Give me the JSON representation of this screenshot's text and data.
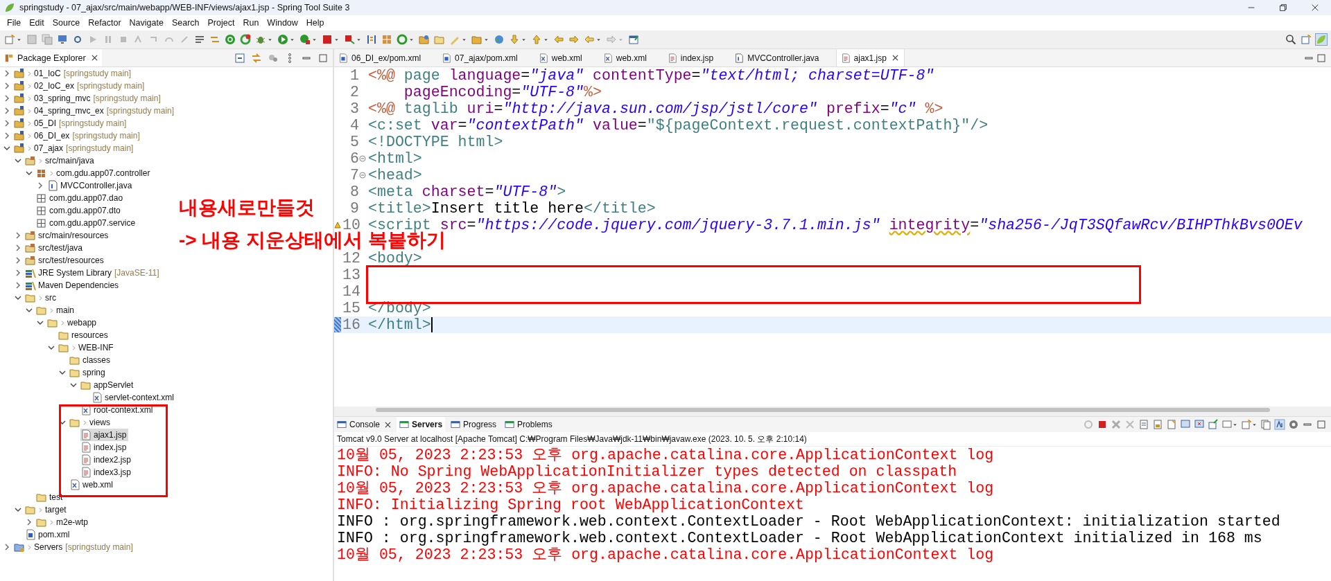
{
  "window": {
    "title": "springstudy - 07_ajax/src/main/webapp/WEB-INF/views/ajax1.jsp - Spring Tool Suite 3"
  },
  "menu": [
    "File",
    "Edit",
    "Source",
    "Refactor",
    "Navigate",
    "Search",
    "Project",
    "Run",
    "Window",
    "Help"
  ],
  "explorer": {
    "title": "Package Explorer",
    "items": [
      {
        "label": "01_IoC",
        "decoration": "[springstudy main]",
        "kind": "project",
        "dirty": true,
        "expanded": false,
        "selected": false
      },
      {
        "label": "02_IoC_ex",
        "decoration": "[springstudy main]",
        "kind": "project",
        "dirty": true,
        "expanded": false,
        "selected": false
      },
      {
        "label": "03_spring_mvc",
        "decoration": "[springstudy main]",
        "kind": "project",
        "dirty": true,
        "expanded": false,
        "selected": false
      },
      {
        "label": "04_spring_mvc_ex",
        "decoration": "[springstudy main]",
        "kind": "project",
        "dirty": true,
        "expanded": false,
        "selected": false
      },
      {
        "label": "05_DI",
        "decoration": "[springstudy main]",
        "kind": "project",
        "dirty": true,
        "expanded": false,
        "selected": false
      },
      {
        "label": "06_DI_ex",
        "decoration": "[springstudy main]",
        "kind": "project",
        "dirty": true,
        "expanded": false,
        "selected": false
      },
      {
        "label": "07_ajax",
        "decoration": "[springstudy main]",
        "kind": "project",
        "dirty": true,
        "expanded": true,
        "selected": false,
        "children": [
          {
            "label": "src/main/java",
            "kind": "source",
            "dirty": true,
            "expanded": true,
            "selected": false,
            "children": [
              {
                "label": "com.gdu.app07.controller",
                "kind": "package",
                "dirty": true,
                "expanded": true,
                "selected": false,
                "children": [
                  {
                    "label": "MVCController.java",
                    "kind": "java",
                    "dirty": false,
                    "expanded": false,
                    "selected": false
                  }
                ]
              },
              {
                "label": "com.gdu.app07.dao",
                "kind": "empty-package",
                "dirty": false,
                "selected": false
              },
              {
                "label": "com.gdu.app07.dto",
                "kind": "empty-package",
                "dirty": false,
                "selected": false
              },
              {
                "label": "com.gdu.app07.service",
                "kind": "empty-package",
                "dirty": false,
                "selected": false
              }
            ]
          },
          {
            "label": "src/main/resources",
            "kind": "source",
            "dirty": false,
            "expanded": false,
            "selected": false
          },
          {
            "label": "src/test/java",
            "kind": "source",
            "dirty": false,
            "expanded": false,
            "selected": false
          },
          {
            "label": "src/test/resources",
            "kind": "source",
            "dirty": false,
            "expanded": false,
            "selected": false
          },
          {
            "label": "JRE System Library",
            "decoration": "[JavaSE-11]",
            "kind": "library",
            "dirty": false,
            "expanded": false,
            "selected": false
          },
          {
            "label": "Maven Dependencies",
            "kind": "library",
            "dirty": false,
            "expanded": false,
            "selected": false
          },
          {
            "label": "src",
            "kind": "folder",
            "dirty": true,
            "expanded": true,
            "selected": false,
            "children": [
              {
                "label": "main",
                "kind": "folder",
                "dirty": true,
                "expanded": true,
                "selected": false,
                "children": [
                  {
                    "label": "webapp",
                    "kind": "folder",
                    "dirty": true,
                    "expanded": true,
                    "selected": false,
                    "children": [
                      {
                        "label": "resources",
                        "kind": "folder",
                        "dirty": false,
                        "selected": false
                      },
                      {
                        "label": "WEB-INF",
                        "kind": "folder",
                        "dirty": true,
                        "expanded": true,
                        "selected": false,
                        "children": [
                          {
                            "label": "classes",
                            "kind": "folder",
                            "dirty": false,
                            "selected": false
                          },
                          {
                            "label": "spring",
                            "kind": "folder",
                            "dirty": false,
                            "expanded": true,
                            "selected": false,
                            "children": [
                              {
                                "label": "appServlet",
                                "kind": "folder",
                                "dirty": false,
                                "expanded": true,
                                "selected": false,
                                "children": [
                                  {
                                    "label": "servlet-context.xml",
                                    "kind": "xml",
                                    "dirty": false,
                                    "selected": false
                                  }
                                ]
                              },
                              {
                                "label": "root-context.xml",
                                "kind": "xml",
                                "dirty": false,
                                "selected": false
                              }
                            ]
                          },
                          {
                            "label": "views",
                            "kind": "folder",
                            "dirty": true,
                            "expanded": true,
                            "selected": false,
                            "children": [
                              {
                                "label": "ajax1.jsp",
                                "kind": "jsp",
                                "dirty": false,
                                "selected": true
                              },
                              {
                                "label": "index.jsp",
                                "kind": "jsp",
                                "dirty": false,
                                "selected": false
                              },
                              {
                                "label": "index2.jsp",
                                "kind": "jsp",
                                "dirty": false,
                                "selected": false
                              },
                              {
                                "label": "index3.jsp",
                                "kind": "jsp",
                                "dirty": false,
                                "selected": false
                              }
                            ]
                          },
                          {
                            "label": "web.xml",
                            "kind": "xml",
                            "dirty": false,
                            "selected": false
                          }
                        ]
                      }
                    ]
                  }
                ]
              },
              {
                "label": "test",
                "kind": "folder",
                "dirty": false,
                "selected": false
              }
            ]
          },
          {
            "label": "target",
            "kind": "folder",
            "dirty": true,
            "expanded": true,
            "selected": false,
            "children": [
              {
                "label": "m2e-wtp",
                "kind": "folder",
                "dirty": true,
                "expanded": false,
                "selected": false
              }
            ]
          },
          {
            "label": "pom.xml",
            "kind": "pom",
            "dirty": false,
            "selected": false
          }
        ]
      },
      {
        "label": "Servers",
        "decoration": "[springstudy main]",
        "kind": "servers",
        "dirty": true,
        "expanded": false,
        "selected": false
      }
    ]
  },
  "editor": {
    "tabs": [
      {
        "label": "06_DI_ex/pom.xml",
        "kind": "pom",
        "selected": false
      },
      {
        "label": "07_ajax/pom.xml",
        "kind": "pom",
        "selected": false
      },
      {
        "label": "web.xml",
        "kind": "xml",
        "selected": false
      },
      {
        "label": "web.xml",
        "kind": "xml",
        "selected": false
      },
      {
        "label": "index.jsp",
        "kind": "jsp",
        "selected": false
      },
      {
        "label": "MVCController.java",
        "kind": "java",
        "selected": false
      },
      {
        "label": "ajax1.jsp",
        "kind": "jsp",
        "selected": true
      }
    ],
    "lines": [
      {
        "number": "1",
        "current": false,
        "tokens": [
          {
            "t": "<%@",
            "kind": "dir"
          },
          {
            "t": " page",
            "kind": "tag"
          },
          {
            "t": " language",
            "kind": "attr"
          },
          {
            "t": "=",
            "kind": "text"
          },
          {
            "t": "\"java\"",
            "kind": "value"
          },
          {
            "t": " contentType",
            "kind": "attr"
          },
          {
            "t": "=",
            "kind": "text"
          },
          {
            "t": "\"text/html; charset=UTF-8\"",
            "kind": "value"
          }
        ]
      },
      {
        "number": "2",
        "current": false,
        "tokens": [
          {
            "t": "    pageEncoding",
            "kind": "attr"
          },
          {
            "t": "=",
            "kind": "text"
          },
          {
            "t": "\"UTF-8\"",
            "kind": "value"
          },
          {
            "t": "%>",
            "kind": "dir"
          }
        ]
      },
      {
        "number": "3",
        "current": false,
        "tokens": [
          {
            "t": "<%@",
            "kind": "dir"
          },
          {
            "t": " taglib",
            "kind": "tag"
          },
          {
            "t": " uri",
            "kind": "attr"
          },
          {
            "t": "=",
            "kind": "text"
          },
          {
            "t": "\"http://java.sun.com/jsp/jstl/core\"",
            "kind": "value"
          },
          {
            "t": " prefix",
            "kind": "attr"
          },
          {
            "t": "=",
            "kind": "text"
          },
          {
            "t": "\"c\"",
            "kind": "value"
          },
          {
            "t": " %>",
            "kind": "dir"
          }
        ]
      },
      {
        "number": "4",
        "current": false,
        "tokens": [
          {
            "t": "<c:set",
            "kind": "tag"
          },
          {
            "t": " var",
            "kind": "attr"
          },
          {
            "t": "=",
            "kind": "text"
          },
          {
            "t": "\"contextPath\"",
            "kind": "value"
          },
          {
            "t": " value",
            "kind": "attr"
          },
          {
            "t": "=",
            "kind": "text"
          },
          {
            "t": "\"${pageContext.request.contextPath}\"",
            "kind": "el"
          },
          {
            "t": "/>",
            "kind": "tag"
          }
        ]
      },
      {
        "number": "5",
        "current": false,
        "tokens": [
          {
            "t": "<!DOCTYPE html>",
            "kind": "tag"
          }
        ]
      },
      {
        "number": "6",
        "current": false,
        "kind": "fold",
        "tokens": [
          {
            "t": "<html>",
            "kind": "tag"
          }
        ]
      },
      {
        "number": "7",
        "current": false,
        "kind": "fold",
        "tokens": [
          {
            "t": "<head>",
            "kind": "tag"
          }
        ]
      },
      {
        "number": "8",
        "current": false,
        "tokens": [
          {
            "t": "<meta",
            "kind": "tag"
          },
          {
            "t": " charset",
            "kind": "attr"
          },
          {
            "t": "=",
            "kind": "text"
          },
          {
            "t": "\"UTF-8\"",
            "kind": "value"
          },
          {
            "t": ">",
            "kind": "tag"
          }
        ]
      },
      {
        "number": "9",
        "current": false,
        "tokens": [
          {
            "t": "<title>",
            "kind": "tag"
          },
          {
            "t": "Insert title here",
            "kind": "text"
          },
          {
            "t": "</title>",
            "kind": "tag"
          }
        ]
      },
      {
        "number": "10",
        "current": false,
        "kind": "warning",
        "tokens": [
          {
            "t": "<script",
            "kind": "tag"
          },
          {
            "t": " src",
            "kind": "attr"
          },
          {
            "t": "=",
            "kind": "text"
          },
          {
            "t": "\"https://code.jquery.com/jquery-3.7.1.min.js\" ",
            "kind": "value"
          },
          {
            "t": "integrity",
            "kind": "attr_warning"
          },
          {
            "t": "=",
            "kind": "text"
          },
          {
            "t": "\"sha256-/JqT3SQfawRcv/BIHPThkBvs0OEv",
            "kind": "value"
          }
        ]
      },
      {
        "current": false
      },
      {
        "number": "12",
        "current": false,
        "tokens": [
          {
            "t": "<body>",
            "kind": "tag"
          }
        ]
      },
      {
        "number": "13",
        "current": false
      },
      {
        "number": "14",
        "current": false
      },
      {
        "number": "15",
        "current": false,
        "tokens": [
          {
            "t": "</body>",
            "kind": "tag"
          }
        ]
      },
      {
        "number": "16",
        "current": true,
        "tokens": [
          {
            "t": "</html>",
            "kind": "tag"
          }
        ]
      }
    ]
  },
  "console": {
    "tabs": [
      {
        "label": "Console",
        "selected": false,
        "closable": true
      },
      {
        "label": "Servers",
        "selected": true,
        "closable": false
      },
      {
        "label": "Progress",
        "selected": false,
        "closable": false
      },
      {
        "label": "Problems",
        "selected": false,
        "closable": false
      }
    ],
    "header": "Tomcat v9.0 Server at localhost [Apache Tomcat] C:₩Program Files₩Java₩jdk-11₩bin₩javaw.exe  (2023. 10. 5. 오후 2:10:14)",
    "lines": [
      {
        "text": "10월 05, 2023 2:23:53 오후 org.apache.catalina.core.ApplicationContext log",
        "kind": "err"
      },
      {
        "text": "INFO: No Spring WebApplicationInitializer types detected on classpath",
        "kind": "err"
      },
      {
        "text": "10월 05, 2023 2:23:53 오후 org.apache.catalina.core.ApplicationContext log",
        "kind": "err"
      },
      {
        "text": "INFO: Initializing Spring root WebApplicationContext",
        "kind": "err"
      },
      {
        "text": "INFO : org.springframework.web.context.ContextLoader - Root WebApplicationContext: initialization started",
        "kind": "out"
      },
      {
        "text": "INFO : org.springframework.web.context.ContextLoader - Root WebApplicationContext initialized in 168 ms",
        "kind": "out"
      },
      {
        "text": "10월 05, 2023 2:23:53 오후 org.apache.catalina.core.ApplicationContext log",
        "kind": "err"
      }
    ]
  },
  "annotation": {
    "notes": [
      "내용새로만들것",
      "-> 내용 지운상태에서 복붙하기"
    ]
  }
}
